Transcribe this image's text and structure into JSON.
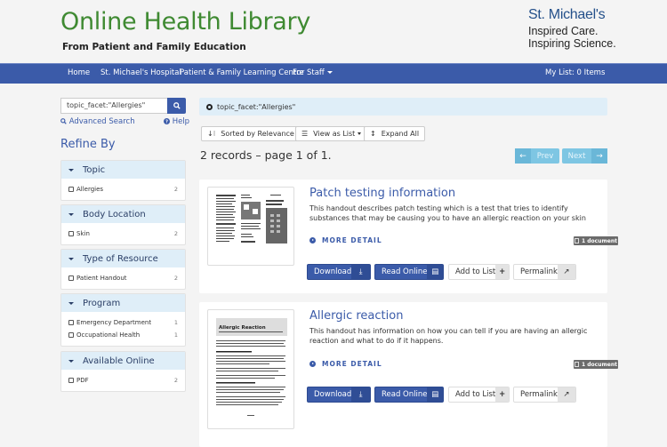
{
  "header": {
    "title": "Online Health Library",
    "subtitle": "From Patient and Family Education",
    "logo_name": "St. Michael's",
    "logo_tag_line1": "Inspired Care.",
    "logo_tag_line2": "Inspiring Science."
  },
  "nav": {
    "items": [
      {
        "label": "Home"
      },
      {
        "label": "St. Michael's Hospital"
      },
      {
        "label": "Patient & Family Learning Centre"
      },
      {
        "label": "For Staff"
      }
    ],
    "my_list": "My List: 0 Items"
  },
  "search": {
    "value": "topic_facet:\"Allergies\"",
    "icon": "search-icon",
    "advanced": "Advanced Search",
    "help": "Help"
  },
  "refine": {
    "title": "Refine By",
    "facets": [
      {
        "title": "Topic",
        "items": [
          {
            "label": "Allergies",
            "count": "2"
          }
        ]
      },
      {
        "title": "Body Location",
        "items": [
          {
            "label": "Skin",
            "count": "2"
          }
        ]
      },
      {
        "title": "Type of Resource",
        "items": [
          {
            "label": "Patient Handout",
            "count": "2"
          }
        ]
      },
      {
        "title": "Program",
        "items": [
          {
            "label": "Emergency Department",
            "count": "1"
          },
          {
            "label": "Occupational Health",
            "count": "1"
          }
        ]
      },
      {
        "title": "Available Online",
        "items": [
          {
            "label": "PDF",
            "count": "2"
          }
        ]
      }
    ]
  },
  "filter": {
    "active": "topic_facet:\"Allergies\""
  },
  "toolbar": {
    "sort": "Sorted by Relevance",
    "view": "View as List",
    "expand": "Expand All"
  },
  "results": {
    "summary": "2 records – page 1 of 1.",
    "prev": "Prev",
    "next": "Next",
    "items": [
      {
        "title": "Patch testing information",
        "description": "This handout describes patch testing which is a test that tries to identify substances that may be causing you to have an allergic reaction on your skin",
        "more": "MORE DETAIL",
        "badge": "1 document",
        "download": "Download",
        "read": "Read Online",
        "add": "Add to List",
        "permalink": "Permalink"
      },
      {
        "title": "Allergic reaction",
        "description": "This handout has information on how you can tell if you are having an allergic reaction and what to do if it happens.",
        "more": "MORE DETAIL",
        "badge": "1 document",
        "download": "Download",
        "read": "Read Online",
        "add": "Add to List",
        "permalink": "Permalink",
        "thumb_heading": "Allergic Reaction"
      }
    ]
  },
  "colors": {
    "brand_blue": "#3b5ba9",
    "title_green": "#3f8a32",
    "facet_header": "#dfeef8",
    "pager": "#7ec6e3"
  }
}
